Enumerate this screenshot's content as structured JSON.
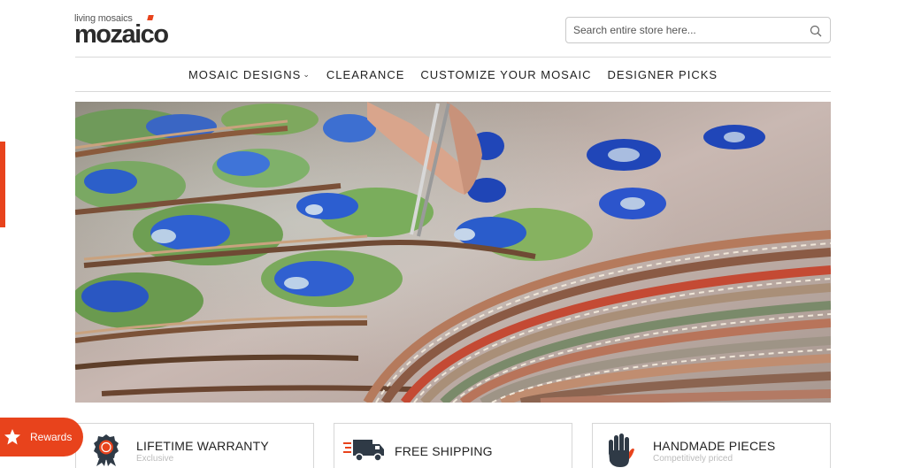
{
  "brand": {
    "tagline": "living mosaics",
    "name": "mozaico"
  },
  "search": {
    "placeholder": "Search entire store here...",
    "icon": "search-icon"
  },
  "nav": {
    "items": [
      {
        "label": "MOSAIC DESIGNS",
        "has_dropdown": true
      },
      {
        "label": "CLEARANCE",
        "has_dropdown": false
      },
      {
        "label": "CUSTOMIZE YOUR MOSAIC",
        "has_dropdown": false
      },
      {
        "label": "DESIGNER PICKS",
        "has_dropdown": false
      }
    ]
  },
  "hero": {
    "image": "artisan-assembling-mosaic-tiles-with-tweezers"
  },
  "features": [
    {
      "title": "LIFETIME WARRANTY",
      "subtitle": "Exclusive",
      "icon": "warranty-badge-icon"
    },
    {
      "title": "FREE SHIPPING",
      "subtitle": "",
      "icon": "delivery-truck-icon"
    },
    {
      "title": "HANDMADE PIECES",
      "subtitle": "Competitively priced",
      "icon": "hand-icon"
    }
  ],
  "rewards": {
    "label": "Rewards",
    "icon": "star-icon"
  },
  "colors": {
    "accent": "#e8431c",
    "text": "#222222",
    "border": "#d6d6d6"
  }
}
